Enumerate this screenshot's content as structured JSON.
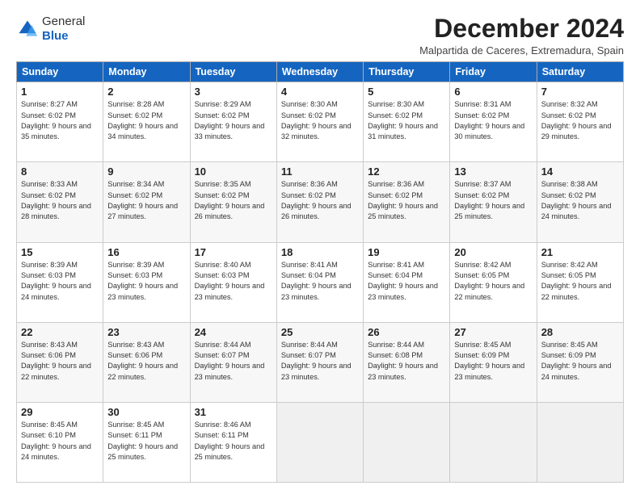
{
  "logo": {
    "general": "General",
    "blue": "Blue"
  },
  "title": "December 2024",
  "location": "Malpartida de Caceres, Extremadura, Spain",
  "days_of_week": [
    "Sunday",
    "Monday",
    "Tuesday",
    "Wednesday",
    "Thursday",
    "Friday",
    "Saturday"
  ],
  "weeks": [
    [
      {
        "day": 1,
        "sunrise": "8:27 AM",
        "sunset": "6:02 PM",
        "daylight": "9 hours and 35 minutes."
      },
      {
        "day": 2,
        "sunrise": "8:28 AM",
        "sunset": "6:02 PM",
        "daylight": "9 hours and 34 minutes."
      },
      {
        "day": 3,
        "sunrise": "8:29 AM",
        "sunset": "6:02 PM",
        "daylight": "9 hours and 33 minutes."
      },
      {
        "day": 4,
        "sunrise": "8:30 AM",
        "sunset": "6:02 PM",
        "daylight": "9 hours and 32 minutes."
      },
      {
        "day": 5,
        "sunrise": "8:30 AM",
        "sunset": "6:02 PM",
        "daylight": "9 hours and 31 minutes."
      },
      {
        "day": 6,
        "sunrise": "8:31 AM",
        "sunset": "6:02 PM",
        "daylight": "9 hours and 30 minutes."
      },
      {
        "day": 7,
        "sunrise": "8:32 AM",
        "sunset": "6:02 PM",
        "daylight": "9 hours and 29 minutes."
      }
    ],
    [
      {
        "day": 8,
        "sunrise": "8:33 AM",
        "sunset": "6:02 PM",
        "daylight": "9 hours and 28 minutes."
      },
      {
        "day": 9,
        "sunrise": "8:34 AM",
        "sunset": "6:02 PM",
        "daylight": "9 hours and 27 minutes."
      },
      {
        "day": 10,
        "sunrise": "8:35 AM",
        "sunset": "6:02 PM",
        "daylight": "9 hours and 26 minutes."
      },
      {
        "day": 11,
        "sunrise": "8:36 AM",
        "sunset": "6:02 PM",
        "daylight": "9 hours and 26 minutes."
      },
      {
        "day": 12,
        "sunrise": "8:36 AM",
        "sunset": "6:02 PM",
        "daylight": "9 hours and 25 minutes."
      },
      {
        "day": 13,
        "sunrise": "8:37 AM",
        "sunset": "6:02 PM",
        "daylight": "9 hours and 25 minutes."
      },
      {
        "day": 14,
        "sunrise": "8:38 AM",
        "sunset": "6:02 PM",
        "daylight": "9 hours and 24 minutes."
      }
    ],
    [
      {
        "day": 15,
        "sunrise": "8:39 AM",
        "sunset": "6:03 PM",
        "daylight": "9 hours and 24 minutes."
      },
      {
        "day": 16,
        "sunrise": "8:39 AM",
        "sunset": "6:03 PM",
        "daylight": "9 hours and 23 minutes."
      },
      {
        "day": 17,
        "sunrise": "8:40 AM",
        "sunset": "6:03 PM",
        "daylight": "9 hours and 23 minutes."
      },
      {
        "day": 18,
        "sunrise": "8:41 AM",
        "sunset": "6:04 PM",
        "daylight": "9 hours and 23 minutes."
      },
      {
        "day": 19,
        "sunrise": "8:41 AM",
        "sunset": "6:04 PM",
        "daylight": "9 hours and 23 minutes."
      },
      {
        "day": 20,
        "sunrise": "8:42 AM",
        "sunset": "6:05 PM",
        "daylight": "9 hours and 22 minutes."
      },
      {
        "day": 21,
        "sunrise": "8:42 AM",
        "sunset": "6:05 PM",
        "daylight": "9 hours and 22 minutes."
      }
    ],
    [
      {
        "day": 22,
        "sunrise": "8:43 AM",
        "sunset": "6:06 PM",
        "daylight": "9 hours and 22 minutes."
      },
      {
        "day": 23,
        "sunrise": "8:43 AM",
        "sunset": "6:06 PM",
        "daylight": "9 hours and 22 minutes."
      },
      {
        "day": 24,
        "sunrise": "8:44 AM",
        "sunset": "6:07 PM",
        "daylight": "9 hours and 23 minutes."
      },
      {
        "day": 25,
        "sunrise": "8:44 AM",
        "sunset": "6:07 PM",
        "daylight": "9 hours and 23 minutes."
      },
      {
        "day": 26,
        "sunrise": "8:44 AM",
        "sunset": "6:08 PM",
        "daylight": "9 hours and 23 minutes."
      },
      {
        "day": 27,
        "sunrise": "8:45 AM",
        "sunset": "6:09 PM",
        "daylight": "9 hours and 23 minutes."
      },
      {
        "day": 28,
        "sunrise": "8:45 AM",
        "sunset": "6:09 PM",
        "daylight": "9 hours and 24 minutes."
      }
    ],
    [
      {
        "day": 29,
        "sunrise": "8:45 AM",
        "sunset": "6:10 PM",
        "daylight": "9 hours and 24 minutes."
      },
      {
        "day": 30,
        "sunrise": "8:45 AM",
        "sunset": "6:11 PM",
        "daylight": "9 hours and 25 minutes."
      },
      {
        "day": 31,
        "sunrise": "8:46 AM",
        "sunset": "6:11 PM",
        "daylight": "9 hours and 25 minutes."
      },
      null,
      null,
      null,
      null
    ]
  ]
}
